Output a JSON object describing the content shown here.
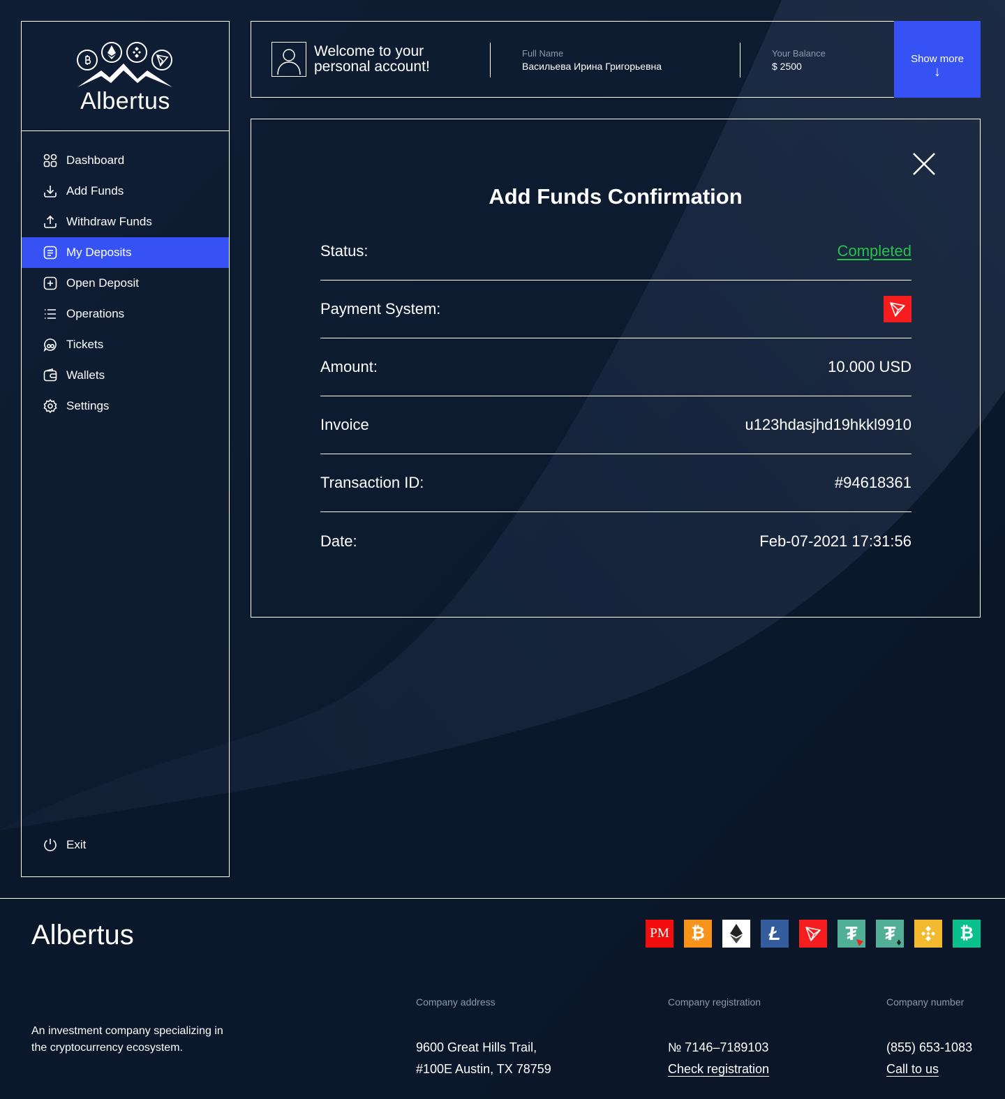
{
  "brand": {
    "name": "Albertus"
  },
  "colors": {
    "accent": "#3652f5",
    "success": "#27c24c",
    "tron": "#f51d1d",
    "muted": "#8c98ab",
    "background": "#0c1a2e"
  },
  "sidebar": {
    "items": [
      {
        "label": "Dashboard",
        "icon": "dashboard-icon"
      },
      {
        "label": "Add Funds",
        "icon": "download-icon"
      },
      {
        "label": "Withdraw Funds",
        "icon": "upload-icon"
      },
      {
        "label": "My Deposits",
        "icon": "deposits-icon",
        "active": true
      },
      {
        "label": "Open Deposit",
        "icon": "plus-square-icon"
      },
      {
        "label": "Operations",
        "icon": "list-icon"
      },
      {
        "label": "Tickets",
        "icon": "chat-icon"
      },
      {
        "label": "Wallets",
        "icon": "wallet-icon"
      },
      {
        "label": "Settings",
        "icon": "gear-icon"
      }
    ],
    "exit_label": "Exit"
  },
  "header": {
    "welcome": "Welcome to your personal account!",
    "full_name_label": "Full Name",
    "full_name": "Васильева Ирина Григорьевна",
    "balance_label": "Your Balance",
    "balance": "$ 2500",
    "show_more": "Show more",
    "show_more_arrow": "↓"
  },
  "modal": {
    "title": "Add Funds Confirmation",
    "status_label": "Status:",
    "status_value": "Completed",
    "payment_label": "Payment System:",
    "payment_icon": "tron-icon",
    "amount_label": "Amount:",
    "amount_value": "10.000 USD",
    "invoice_label": "Invoice",
    "invoice_value": "u123hdasjhd19hkkl9910",
    "txid_label": "Transaction ID:",
    "txid_value": "#94618361",
    "date_label": "Date:",
    "date_value": "Feb-07-2021 17:31:56"
  },
  "footer": {
    "description": "An investment company specializing in the cryptocurrency ecosystem.",
    "coins": [
      {
        "name": "perfect-money-icon",
        "text": "PM",
        "bg": "#f20d0d"
      },
      {
        "name": "bitcoin-icon",
        "text": "₿",
        "bg": "#f7931a"
      },
      {
        "name": "ethereum-icon",
        "text": "",
        "bg": "#ffffff"
      },
      {
        "name": "litecoin-icon",
        "text": "Ł",
        "bg": "#345d9d"
      },
      {
        "name": "tron-icon",
        "text": "",
        "bg": "#f51d1d"
      },
      {
        "name": "tether-trc20-icon",
        "text": "₮",
        "bg": "#50af95"
      },
      {
        "name": "tether-erc20-icon",
        "text": "₮",
        "bg": "#50af95"
      },
      {
        "name": "binance-icon",
        "text": "◈",
        "bg": "#f3ba2f"
      },
      {
        "name": "bitcoin-cash-icon",
        "text": "₿",
        "bg": "#0ac18e"
      }
    ],
    "address_label": "Company address",
    "address_line1": "9600 Great Hills Trail,",
    "address_line2": "#100E Austin, TX 78759",
    "registration_label": "Company registration",
    "registration_number": "№ 7146–7189103",
    "registration_link": "Check registration",
    "number_label": "Company number",
    "phone": "(855) 653-1083",
    "call_link": "Call to us"
  }
}
